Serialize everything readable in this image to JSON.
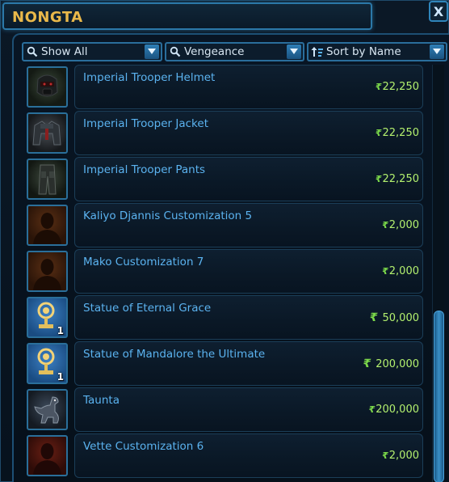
{
  "window": {
    "title": "NONGTA",
    "close_label": "X"
  },
  "filters": {
    "show": {
      "label": "Show All",
      "icon": "search-icon"
    },
    "vendor": {
      "label": "Vengeance",
      "icon": "search-icon"
    },
    "sort": {
      "label": "Sort by Name",
      "icon": "sort-icon"
    }
  },
  "items": [
    {
      "name": "Imperial Trooper Helmet",
      "price": "22,250",
      "icon": "helmet-icon",
      "qty": ""
    },
    {
      "name": "Imperial Trooper Jacket",
      "price": "22,250",
      "icon": "jacket-icon",
      "qty": ""
    },
    {
      "name": "Imperial Trooper Pants",
      "price": "22,250",
      "icon": "pants-icon",
      "qty": ""
    },
    {
      "name": "Kaliyo Djannis Customization 5",
      "price": "2,000",
      "icon": "companion-silhouette-icon",
      "qty": ""
    },
    {
      "name": "Mako Customization 7",
      "price": "2,000",
      "icon": "companion-silhouette-icon",
      "qty": ""
    },
    {
      "name": "Statue of Eternal Grace",
      "price": "50,000",
      "icon": "statue-icon",
      "qty": "1"
    },
    {
      "name": "Statue of Mandalore the Ultimate",
      "price": "200,000",
      "icon": "statue-icon",
      "qty": "1"
    },
    {
      "name": "Taunta",
      "price": "200,000",
      "icon": "creature-icon",
      "qty": ""
    },
    {
      "name": "Vette Customization 6",
      "price": "2,000",
      "icon": "companion-silhouette-icon",
      "qty": ""
    }
  ],
  "colors": {
    "title": "#e9b84a",
    "item_name": "#5bb3f0",
    "price": "#b3f06e",
    "border": "#2a6f9a"
  }
}
